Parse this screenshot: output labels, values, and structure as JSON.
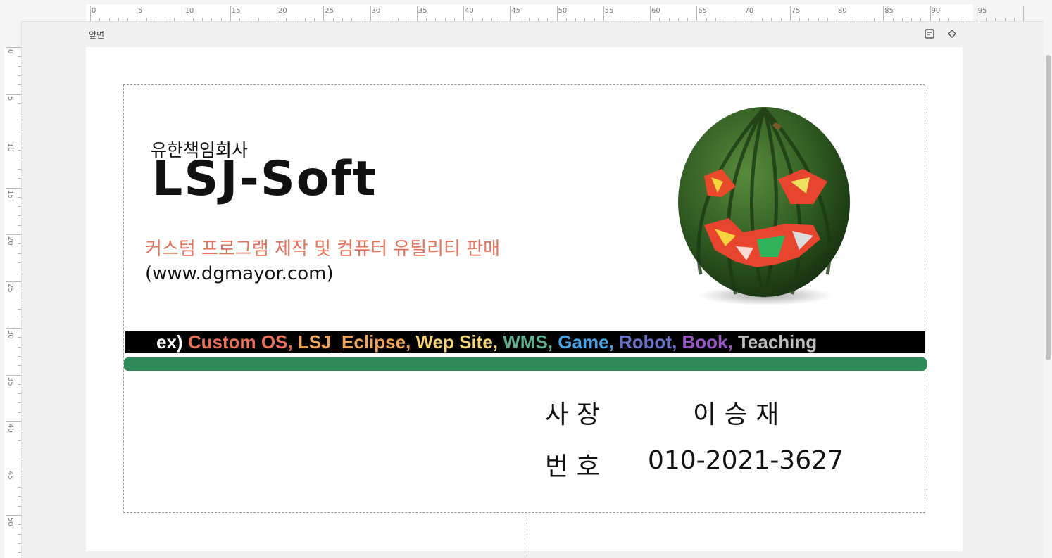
{
  "ruler": {
    "horizontal_labels": [
      "0",
      "5",
      "10",
      "15",
      "20",
      "25",
      "30",
      "35",
      "40",
      "45",
      "50",
      "55",
      "60",
      "65",
      "70",
      "75",
      "80",
      "85",
      "90",
      "95"
    ],
    "vertical_labels": [
      "0",
      "5",
      "10",
      "15",
      "20",
      "25",
      "30",
      "35",
      "40",
      "45",
      "50"
    ]
  },
  "page": {
    "label": "앞면",
    "memo_icon": "memo-icon",
    "fill_icon": "paint-bucket-icon"
  },
  "card": {
    "company_type": "유한책임회사",
    "company_name": "LSJ-Soft",
    "slogan": "커스텀 프로그램 제작 및 컴퓨터 유틸리티 판매",
    "website": "(www.dgmayor.com)",
    "examples": [
      {
        "text": "ex) ",
        "color": "#ffffff"
      },
      {
        "text": "Custom OS, ",
        "color": "#e8715c"
      },
      {
        "text": "LSJ_Eclipse, ",
        "color": "#f0a35a"
      },
      {
        "text": "Wep Site, ",
        "color": "#f5d37a"
      },
      {
        "text": "WMS, ",
        "color": "#5fae8c"
      },
      {
        "text": "Game, ",
        "color": "#4ba3e3"
      },
      {
        "text": "Robot, ",
        "color": "#6b73c9"
      },
      {
        "text": "Book, ",
        "color": "#9a56c4"
      },
      {
        "text": "Teaching",
        "color": "#bdbdbd"
      }
    ],
    "title_label": "사 장",
    "person_name": "이 승 재",
    "phone_label": "번 호",
    "phone_number": "010-2021-3627",
    "accent_bar_color": "#2e8b57",
    "image": "watermelon-jack-o-lantern"
  }
}
